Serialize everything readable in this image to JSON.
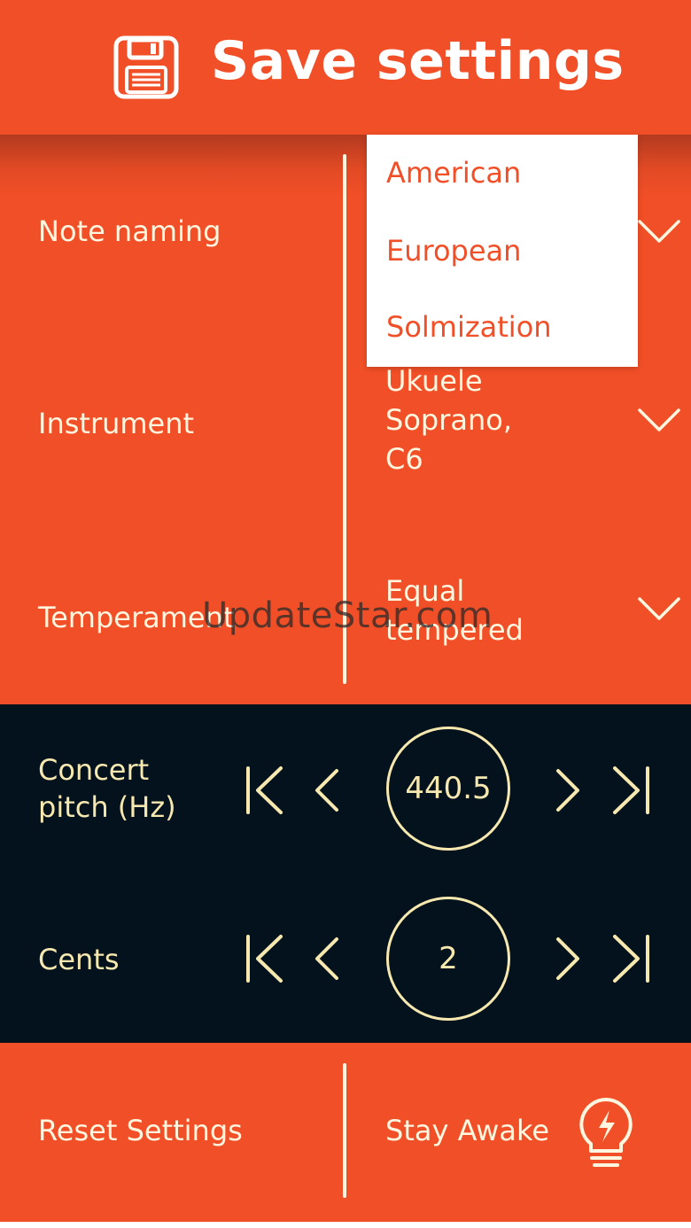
{
  "header": {
    "title": "Save settings",
    "icon": "floppy-disk-icon"
  },
  "settings": {
    "note_naming": {
      "label": "Note naming"
    },
    "instrument": {
      "label": "Instrument",
      "value_lines": [
        "Ukuele",
        "Soprano,",
        "C6"
      ]
    },
    "temperament": {
      "label": "Temperament",
      "value_lines": [
        "Equal",
        "tempered"
      ]
    }
  },
  "dropdown": {
    "options": [
      "American",
      "European",
      "Solmization"
    ]
  },
  "watermark": "UpdateStar.com",
  "concert_pitch": {
    "label_lines": [
      "Concert",
      "pitch (Hz)"
    ],
    "value": "440.5"
  },
  "cents": {
    "label": "Cents",
    "value": "2"
  },
  "footer": {
    "reset_label": "Reset Settings",
    "stay_awake_label": "Stay Awake",
    "stay_awake_icon": "lightbulb-bolt-icon"
  },
  "colors": {
    "accent": "#f14f27",
    "dark_panel": "#03121c",
    "cream": "#f7e8b0",
    "text_light": "#fff6df"
  }
}
